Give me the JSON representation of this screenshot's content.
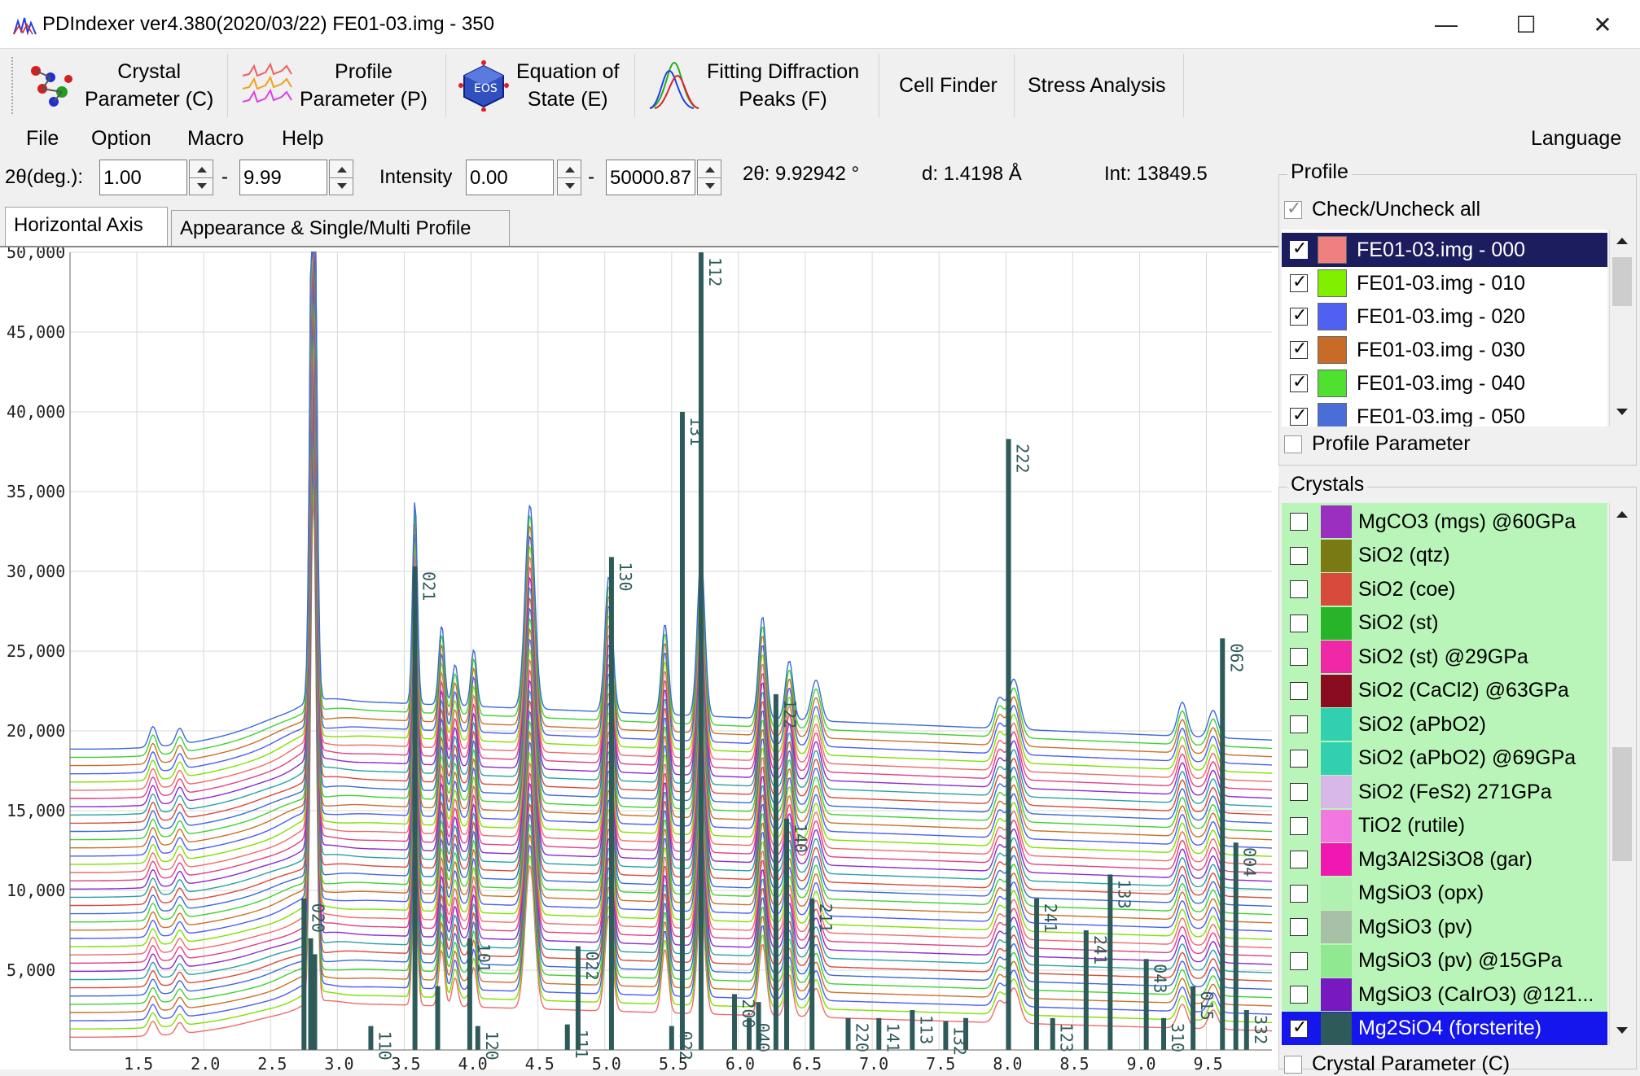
{
  "window": {
    "title": "PDIndexer   ver4.380(2020/03/22)   FE01-03.img - 350",
    "minimize": "—",
    "maximize": "☐",
    "close": "✕"
  },
  "toolbar": {
    "crystal_label": "Crystal\nParameter (C)",
    "profile_label": "Profile\nParameter (P)",
    "eos_label": "Equation of\nState (E)",
    "fitting_label": "Fitting Diffraction\nPeaks (F)",
    "cellfinder_label": "Cell Finder",
    "stress_label": "Stress Analysis"
  },
  "menu": {
    "file": "File",
    "option": "Option",
    "macro": "Macro",
    "help": "Help",
    "language": "Language"
  },
  "range": {
    "two_theta_label": "2θ(deg.):",
    "two_theta_min": "1.00",
    "dash1": "-",
    "two_theta_max": "9.99",
    "intensity_label": "Intensity",
    "intensity_min": "0.00",
    "dash2": "-",
    "intensity_max": "50000.87",
    "cursor_2theta": "2θ: 9.92942 °",
    "cursor_d": "d: 1.4198 Å",
    "cursor_int": "Int: 13849.5"
  },
  "tabs": {
    "horizontal_axis": "Horizontal Axis",
    "appearance": "Appearance & Single/Multi Profile"
  },
  "profile_panel": {
    "title": "Profile",
    "check_all": "Check/Uncheck all",
    "profile_parameter": "Profile Parameter",
    "items": [
      {
        "name": "FE01-03.img - 000",
        "color": "#f08080",
        "checked": true
      },
      {
        "name": "FE01-03.img - 010",
        "color": "#80f000",
        "checked": true
      },
      {
        "name": "FE01-03.img - 020",
        "color": "#5060f0",
        "checked": true
      },
      {
        "name": "FE01-03.img - 030",
        "color": "#c86a28",
        "checked": true
      },
      {
        "name": "FE01-03.img - 040",
        "color": "#50e030",
        "checked": true
      },
      {
        "name": "FE01-03.img - 050",
        "color": "#4a6ed8",
        "checked": true
      }
    ]
  },
  "crystals_panel": {
    "title": "Crystals",
    "crystal_parameter": "Crystal Parameter (C)",
    "items": [
      {
        "name": "MgCO3 (mgs) @60GPa",
        "color": "#9b2fc0",
        "checked": false
      },
      {
        "name": "SiO2 (qtz)",
        "color": "#7a7a14",
        "checked": false
      },
      {
        "name": "SiO2 (coe)",
        "color": "#d84a3a",
        "checked": false
      },
      {
        "name": "SiO2 (st)",
        "color": "#28b428",
        "checked": false
      },
      {
        "name": "SiO2 (st) @29GPa",
        "color": "#f028a8",
        "checked": false
      },
      {
        "name": "SiO2 (CaCl2) @63GPa",
        "color": "#8a0c20",
        "checked": false
      },
      {
        "name": "SiO2 (aPbO2)",
        "color": "#30d0b0",
        "checked": false
      },
      {
        "name": "SiO2 (aPbO2) @69GPa",
        "color": "#30d0b0",
        "checked": false
      },
      {
        "name": "SiO2 (FeS2) 271GPa",
        "color": "#d8b8e8",
        "checked": false
      },
      {
        "name": "TiO2 (rutile)",
        "color": "#f078e0",
        "checked": false
      },
      {
        "name": "Mg3Al2Si3O8 (gar)",
        "color": "#f018b0",
        "checked": false
      },
      {
        "name": "MgSiO3 (opx)",
        "color": "#b0f0b0",
        "checked": false
      },
      {
        "name": "MgSiO3 (pv)",
        "color": "#a8c0a8",
        "checked": false
      },
      {
        "name": "MgSiO3 (pv) @15GPa",
        "color": "#90e890",
        "checked": false
      },
      {
        "name": "MgSiO3 (CaIrO3) @121...",
        "color": "#7818c0",
        "checked": false
      },
      {
        "name": "Mg2SiO4 (forsterite)",
        "color": "#2e5a5a",
        "checked": true
      }
    ]
  },
  "chart_data": {
    "type": "line",
    "xlim": [
      1.0,
      9.99
    ],
    "ylim": [
      0,
      50000
    ],
    "x_ticks": [
      "1.5",
      "2.0",
      "2.5",
      "3.0",
      "3.5",
      "4.0",
      "4.5",
      "5.0",
      "5.5",
      "6.0",
      "6.5",
      "7.0",
      "7.5",
      "8.0",
      "8.5",
      "9.0",
      "9.5"
    ],
    "y_ticks": [
      "5,000",
      "10,000",
      "15,000",
      "20,000",
      "25,000",
      "30,000",
      "35,000",
      "40,000",
      "45,000",
      "50,000"
    ],
    "grid": true,
    "profile_count": 36,
    "profile_colors": [
      "#f06a6a",
      "#80e000",
      "#4a5ef0",
      "#c8702a",
      "#40d030",
      "#3a6ad8",
      "#d84a3a",
      "#2aa0a0",
      "#8a2ad0",
      "#e04080"
    ],
    "background_peaks": [
      {
        "x": 1.62,
        "h": 900,
        "w": 0.04
      },
      {
        "x": 1.82,
        "h": 700,
        "w": 0.04
      },
      {
        "x": 2.82,
        "h": 32000,
        "w": 0.03
      },
      {
        "x": 3.58,
        "h": 9000,
        "w": 0.025
      },
      {
        "x": 3.78,
        "h": 3500,
        "w": 0.03
      },
      {
        "x": 3.88,
        "h": 1800,
        "w": 0.03
      },
      {
        "x": 4.02,
        "h": 2500,
        "w": 0.03
      },
      {
        "x": 4.44,
        "h": 9000,
        "w": 0.05
      },
      {
        "x": 5.03,
        "h": 6000,
        "w": 0.04
      },
      {
        "x": 5.45,
        "h": 4000,
        "w": 0.035
      },
      {
        "x": 5.72,
        "h": 7000,
        "w": 0.04
      },
      {
        "x": 6.18,
        "h": 4500,
        "w": 0.04
      },
      {
        "x": 6.38,
        "h": 2600,
        "w": 0.04
      },
      {
        "x": 6.58,
        "h": 1800,
        "w": 0.05
      },
      {
        "x": 7.95,
        "h": 1300,
        "w": 0.05
      },
      {
        "x": 8.06,
        "h": 2200,
        "w": 0.06
      },
      {
        "x": 9.32,
        "h": 1500,
        "w": 0.05
      },
      {
        "x": 9.55,
        "h": 1200,
        "w": 0.05
      }
    ],
    "reference_peaks": [
      {
        "x": 2.75,
        "h": 9500,
        "hkl": "020"
      },
      {
        "x": 2.8,
        "h": 7000,
        "hkl": ""
      },
      {
        "x": 2.83,
        "h": 6000,
        "hkl": ""
      },
      {
        "x": 3.25,
        "h": 1500,
        "hkl": "110"
      },
      {
        "x": 3.58,
        "h": 30300,
        "hkl": "021"
      },
      {
        "x": 3.75,
        "h": 4000,
        "hkl": ""
      },
      {
        "x": 3.99,
        "h": 7000,
        "hkl": "101"
      },
      {
        "x": 4.05,
        "h": 1500,
        "hkl": "120"
      },
      {
        "x": 4.72,
        "h": 1600,
        "hkl": "111"
      },
      {
        "x": 4.8,
        "h": 6500,
        "hkl": "022"
      },
      {
        "x": 5.05,
        "h": 30900,
        "hkl": "130"
      },
      {
        "x": 5.5,
        "h": 1500,
        "hkl": "022"
      },
      {
        "x": 5.58,
        "h": 40000,
        "hkl": "131"
      },
      {
        "x": 5.72,
        "h": 50000,
        "hkl": "112"
      },
      {
        "x": 5.97,
        "h": 3500,
        "hkl": "200"
      },
      {
        "x": 6.08,
        "h": 2000,
        "hkl": "040"
      },
      {
        "x": 6.15,
        "h": 3000,
        "hkl": ""
      },
      {
        "x": 6.28,
        "h": 22300,
        "hkl": "122"
      },
      {
        "x": 6.36,
        "h": 14500,
        "hkl": "140"
      },
      {
        "x": 6.55,
        "h": 9500,
        "hkl": "211"
      },
      {
        "x": 6.82,
        "h": 2000,
        "hkl": "220"
      },
      {
        "x": 7.05,
        "h": 2000,
        "hkl": "141"
      },
      {
        "x": 7.3,
        "h": 2500,
        "hkl": "113"
      },
      {
        "x": 7.55,
        "h": 1800,
        "hkl": "132"
      },
      {
        "x": 7.7,
        "h": 2000,
        "hkl": ""
      },
      {
        "x": 8.02,
        "h": 38300,
        "hkl": "222"
      },
      {
        "x": 8.23,
        "h": 9500,
        "hkl": "241"
      },
      {
        "x": 8.35,
        "h": 2000,
        "hkl": "123"
      },
      {
        "x": 8.6,
        "h": 7500,
        "hkl": "241"
      },
      {
        "x": 8.78,
        "h": 11000,
        "hkl": "133"
      },
      {
        "x": 9.05,
        "h": 5700,
        "hkl": "043"
      },
      {
        "x": 9.18,
        "h": 2000,
        "hkl": "310"
      },
      {
        "x": 9.4,
        "h": 4000,
        "hkl": "015"
      },
      {
        "x": 9.62,
        "h": 25800,
        "hkl": "062"
      },
      {
        "x": 9.72,
        "h": 13000,
        "hkl": "004"
      },
      {
        "x": 9.8,
        "h": 2500,
        "hkl": "332"
      }
    ]
  }
}
